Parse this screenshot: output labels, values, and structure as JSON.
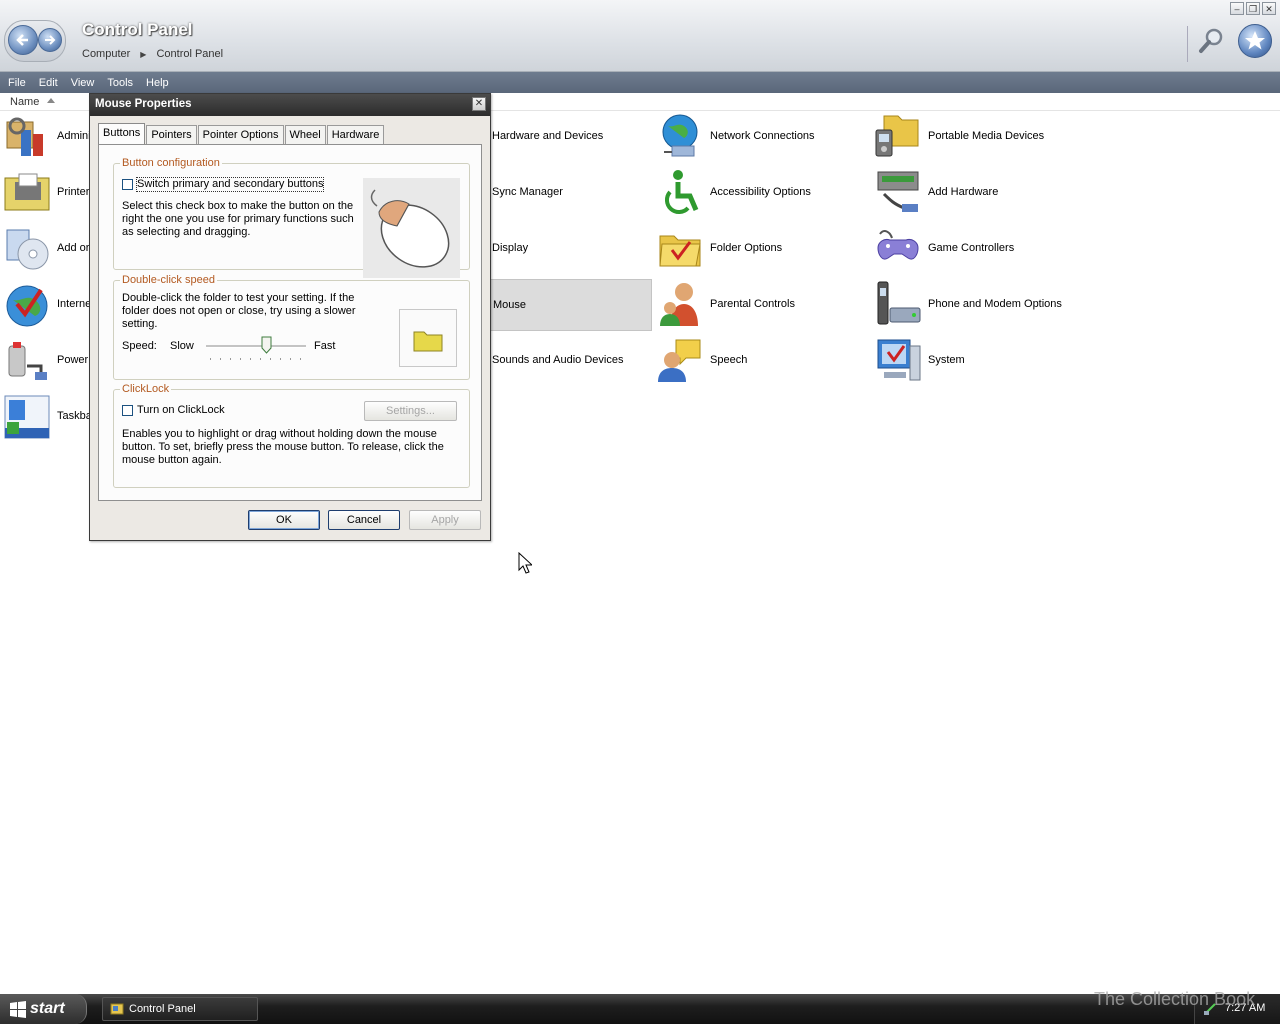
{
  "window": {
    "title": "Control Panel",
    "breadcrumb": [
      "Computer",
      "Control Panel"
    ]
  },
  "menu": [
    "File",
    "Edit",
    "View",
    "Tools",
    "Help"
  ],
  "column_header": "Name",
  "items_left_partial": [
    "Admini",
    "Printer",
    "Add or",
    "Interne",
    "Power",
    "Taskba"
  ],
  "items": {
    "col1": [
      "Hardware and Devices",
      "Sync Manager",
      "Display",
      "Mouse",
      "Sounds and Audio Devices"
    ],
    "col2": [
      "Network Connections",
      "Accessibility Options",
      "Folder Options",
      "Parental Controls",
      "Speech"
    ],
    "col3": [
      "Portable Media Devices",
      "Add Hardware",
      "Game Controllers",
      "Phone and Modem Options",
      "System"
    ]
  },
  "dialog": {
    "title": "Mouse Properties",
    "tabs": [
      "Buttons",
      "Pointers",
      "Pointer Options",
      "Wheel",
      "Hardware"
    ],
    "active_tab": "Buttons",
    "button_config": {
      "title": "Button configuration",
      "checkbox_label": "Switch primary and secondary buttons",
      "checked": false,
      "description": "Select this check box to make the button on the right the one you use for primary functions such as selecting and dragging."
    },
    "double_click": {
      "title": "Double-click speed",
      "description": "Double-click the folder to test your setting. If the folder does not open or close, try using a slower setting.",
      "speed_label": "Speed:",
      "slow": "Slow",
      "fast": "Fast",
      "speed_value": 0.6
    },
    "clicklock": {
      "title": "ClickLock",
      "checkbox_label": "Turn on ClickLock",
      "checked": false,
      "settings_button": "Settings...",
      "description": "Enables you to highlight or drag without holding down the mouse button. To set, briefly press the mouse button. To release, click the mouse button again."
    },
    "buttons": {
      "ok": "OK",
      "cancel": "Cancel",
      "apply": "Apply"
    }
  },
  "taskbar": {
    "start": "start",
    "task": "Control Panel",
    "clock": "7:27 AM"
  },
  "watermark": "The Collection Book",
  "colors": {
    "accent": "#b35a21",
    "menubar": "#5e6b7e",
    "taskbar": "#1e1e1e"
  }
}
